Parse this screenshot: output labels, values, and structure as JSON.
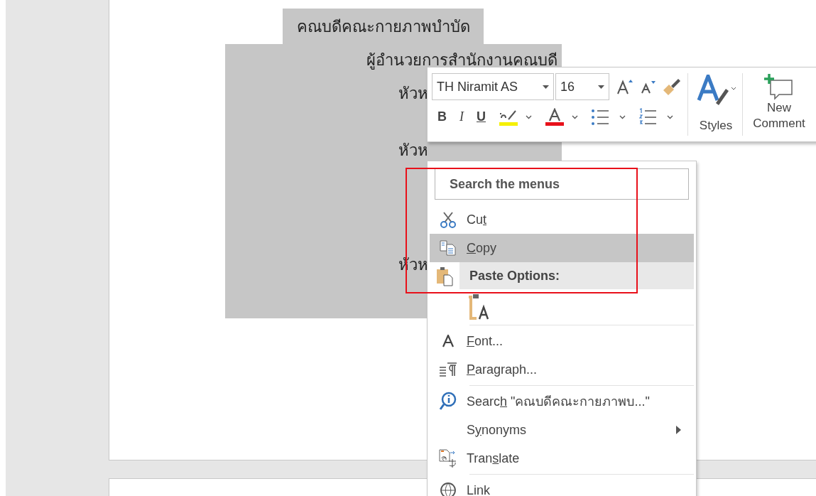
{
  "document": {
    "title_line": "คณบดีคณะกายภาพบำบัด",
    "lines": [
      "ผู้อำนวยการสำนักงานคณบดี",
      "หัวห",
      "หัวห",
      "หัวห"
    ]
  },
  "mini_toolbar": {
    "font": "TH Niramit AS",
    "size": "16",
    "format_buttons": [
      "B",
      "I",
      "U"
    ],
    "styles_label": "Styles",
    "comment_label": [
      "New",
      "Comment"
    ]
  },
  "context_menu": {
    "search_placeholder": "Search the menus",
    "items": [
      {
        "kind": "item",
        "before": "Cu",
        "key": "t",
        "selected": false
      },
      {
        "kind": "item",
        "key": "C",
        "after": "opy",
        "selected": true
      },
      {
        "kind": "header",
        "label": "Paste Options:"
      },
      {
        "kind": "paste"
      },
      {
        "kind": "separator"
      },
      {
        "kind": "item",
        "key": "F",
        "after": "ont...",
        "selected": false
      },
      {
        "kind": "item",
        "key": "P",
        "after": "aragraph...",
        "selected": false
      },
      {
        "kind": "separator"
      },
      {
        "kind": "item",
        "before": "Searc",
        "key": "h",
        "after": " \"คณบดีคณะกายภาพบ...\"",
        "selected": false
      },
      {
        "kind": "item",
        "before": "S",
        "key": "y",
        "after": "nonyms",
        "selected": false,
        "submenu": true
      },
      {
        "kind": "item",
        "before": "Tran",
        "key": "s",
        "after": "late",
        "selected": false
      },
      {
        "kind": "separator"
      },
      {
        "kind": "item",
        "before": "Link",
        "selected": false
      }
    ]
  }
}
